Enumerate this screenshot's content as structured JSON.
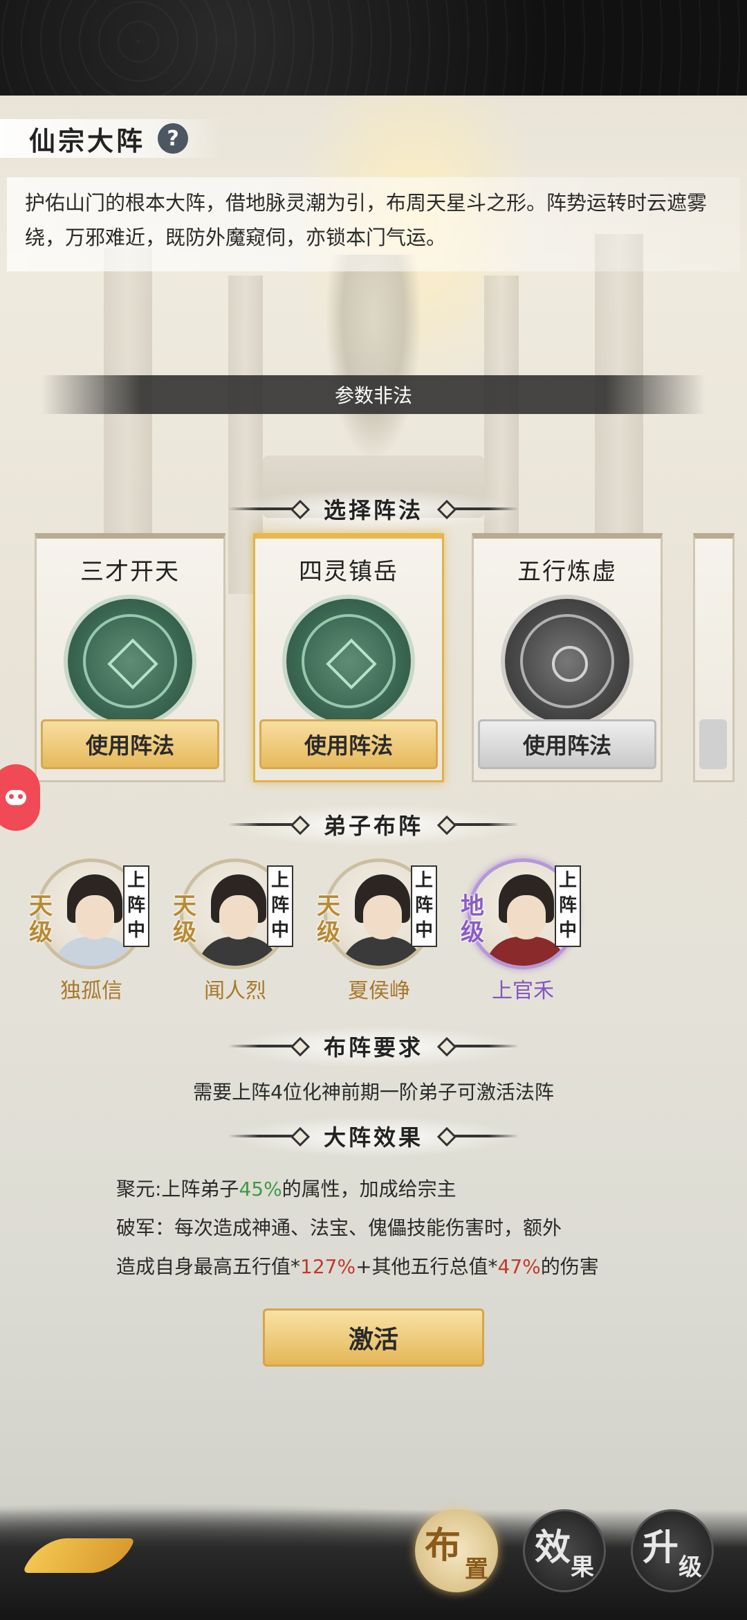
{
  "header": {
    "title": "仙宗大阵",
    "help_icon": "?",
    "description": "护佑山门的根本大阵，借地脉灵潮为引，布周天星斗之形。阵势运转时云遮雾绕，万邪难近，既防外魔窥伺，亦锁本门气运。",
    "banner": "参数非法"
  },
  "sections": {
    "select": "选择阵法",
    "disciples": "弟子布阵",
    "requirement": "布阵要求",
    "effect": "大阵效果"
  },
  "formations": [
    {
      "name": "三才开天",
      "button": "使用阵法",
      "style": "gold"
    },
    {
      "name": "四灵镇岳",
      "button": "使用阵法",
      "style": "gold",
      "selected": true
    },
    {
      "name": "五行炼虚",
      "button": "使用阵法",
      "style": "grey"
    }
  ],
  "disciples": [
    {
      "name": "独孤信",
      "grade": "天级",
      "status": "上阵中"
    },
    {
      "name": "闻人烈",
      "grade": "天级",
      "status": "上阵中"
    },
    {
      "name": "夏侯峥",
      "grade": "天级",
      "status": "上阵中"
    },
    {
      "name": "上官禾",
      "grade": "地级",
      "status": "上阵中"
    }
  ],
  "requirement_text": "需要上阵4位化神前期一阶弟子可激活法阵",
  "effects": {
    "line1_prefix": "聚元:上阵弟子",
    "line1_value": "45%",
    "line1_suffix": "的属性，加成给宗主",
    "line2": "破军：每次造成神通、法宝、傀儡技能伤害时，额外",
    "line3_prefix": "造成自身最高五行值*",
    "line3_value1": "127%",
    "line3_mid": "+其他五行总值*",
    "line3_value2": "47%",
    "line3_suffix": "的伤害"
  },
  "activate_button": "激活",
  "bottom_nav": [
    {
      "big": "布",
      "small": "置",
      "active": true
    },
    {
      "big": "效",
      "small": "果",
      "active": false
    },
    {
      "big": "升",
      "small": "级",
      "active": false
    }
  ]
}
